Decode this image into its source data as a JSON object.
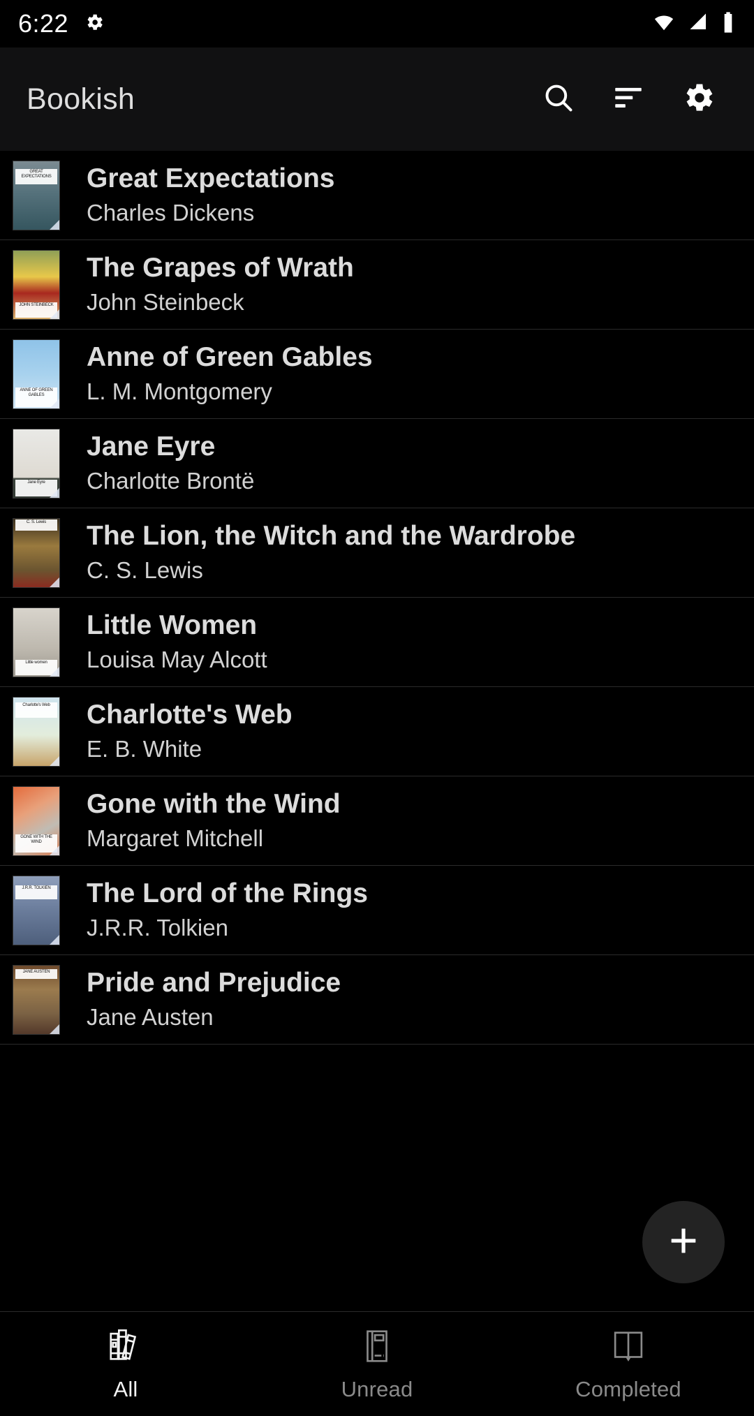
{
  "status_bar": {
    "time": "6:22",
    "icons": [
      "gear-icon",
      "wifi-icon",
      "cell-signal-icon",
      "battery-icon"
    ]
  },
  "app_bar": {
    "title": "Bookish",
    "actions": [
      {
        "name": "search-icon",
        "label": "Search"
      },
      {
        "name": "sort-icon",
        "label": "Sort"
      },
      {
        "name": "gear-icon",
        "label": "Settings"
      }
    ]
  },
  "books": [
    {
      "title": "Great Expectations",
      "author": "Charles Dickens",
      "cover": {
        "bg": "linear-gradient(180deg,#7c8b92 0%,#56727c 45%,#35565f 100%)",
        "band_text": "GREAT EXPECTATIONS",
        "band_top": "12%",
        "band_height": "22%"
      }
    },
    {
      "title": "The Grapes of Wrath",
      "author": "John Steinbeck",
      "cover": {
        "bg": "linear-gradient(180deg,#8f9f57 0%,#e8c84a 38%,#a8281f 62%,#d8b06a 100%)",
        "band_text": "JOHN STEINBECK",
        "band_top": "76%",
        "band_height": "22%"
      }
    },
    {
      "title": "Anne of Green Gables",
      "author": "L. M. Montgomery",
      "cover": {
        "bg": "linear-gradient(180deg,#8fc3e8 0%,#a8d2ee 50%,#cfe4f3 100%)",
        "band_text": "ANNE OF GREEN GABLES",
        "band_top": "70%",
        "band_height": "28%"
      }
    },
    {
      "title": "Jane Eyre",
      "author": "Charlotte Brontë",
      "cover": {
        "bg": "linear-gradient(180deg,#e9e9e6 0%,#dedad2 70%,#3c443c 72%,#323a33 100%)",
        "band_text": "Jane Eyre",
        "band_top": "74%",
        "band_height": "24%"
      }
    },
    {
      "title": "The Lion, the Witch and the Wardrobe",
      "author": "C. S. Lewis",
      "cover": {
        "bg": "linear-gradient(180deg,#3a2f1e 0%,#9a7a3e 40%,#6b5530 75%,#8a2b20 100%)",
        "band_text": "C. S. Lewis",
        "band_top": "2%",
        "band_height": "16%"
      }
    },
    {
      "title": "Little Women",
      "author": "Louisa May Alcott",
      "cover": {
        "bg": "linear-gradient(180deg,#d8d4cc 0%,#bdb8ae 60%,#9d988f 100%)",
        "band_text": "Little women",
        "band_top": "76%",
        "band_height": "22%"
      }
    },
    {
      "title": "Charlotte's Web",
      "author": "E. B. White",
      "cover": {
        "bg": "linear-gradient(180deg,#cfe4ee 0%,#e3eddc 55%,#c7a46a 100%)",
        "band_text": "Charlotte's Web",
        "band_top": "8%",
        "band_height": "22%"
      }
    },
    {
      "title": "Gone with the Wind",
      "author": "Margaret Mitchell",
      "cover": {
        "bg": "linear-gradient(150deg,#e46b3c 0%,#e8a07a 35%,#c0bcb4 65%,#d87f55 100%)",
        "band_text": "GONE WITH THE WIND",
        "band_top": "70%",
        "band_height": "26%"
      }
    },
    {
      "title": "The Lord of the Rings",
      "author": "J.R.R. Tolkien",
      "cover": {
        "bg": "linear-gradient(180deg,#8f9fbb 0%,#6d7f9e 45%,#4e5f7c 100%)",
        "band_text": "J.R.R. TOLKIEN",
        "band_top": "14%",
        "band_height": "20%"
      }
    },
    {
      "title": "Pride and Prejudice",
      "author": "Jane Austen",
      "cover": {
        "bg": "linear-gradient(180deg,#6e4a2c 0%,#9b7b4e 35%,#7b6244 70%,#54392a 100%)",
        "band_text": "JANE AUSTEN",
        "band_top": "6%",
        "band_height": "14%"
      }
    }
  ],
  "fab": {
    "name": "add-book-fab",
    "label": "+"
  },
  "bottom_nav": {
    "items": [
      {
        "label": "All",
        "icon": "books-stack-icon",
        "active": true
      },
      {
        "label": "Unread",
        "icon": "closed-book-icon",
        "active": false
      },
      {
        "label": "Completed",
        "icon": "open-book-icon",
        "active": false
      }
    ]
  }
}
